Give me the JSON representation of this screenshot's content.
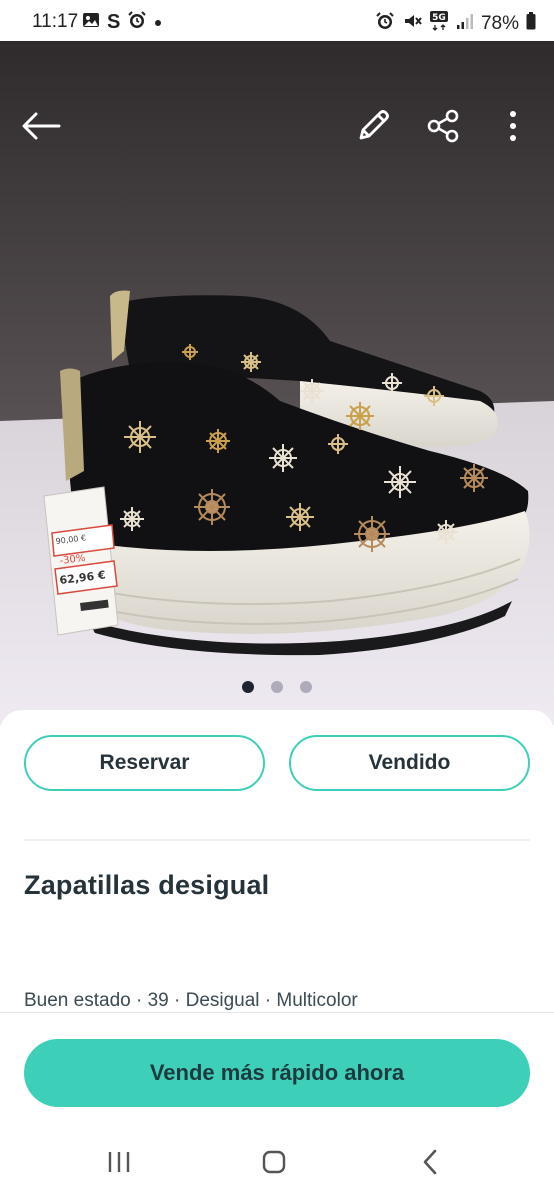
{
  "status_bar": {
    "time": "11:17",
    "left_icons": [
      "image-icon",
      "s-app-icon",
      "alarm-icon",
      "dot-icon"
    ],
    "right_icons": [
      "alarm-icon",
      "mute-icon",
      "5g-icon",
      "signal-icon"
    ],
    "battery": "78%"
  },
  "photo": {
    "toolbar_icons": [
      "back-arrow-icon",
      "pencil-icon",
      "share-icon",
      "more-vert-icon"
    ],
    "price_tag": {
      "old_price": "90,00 €",
      "discount": "-30%",
      "new_price": "62,96 €"
    },
    "carousel": {
      "count": 3,
      "active": 1
    }
  },
  "actions": {
    "reserve_label": "Reservar",
    "sold_label": "Vendido"
  },
  "listing": {
    "title": "Zapatillas desigual",
    "details": "Buen estado · 39 · Desigual · Multicolor"
  },
  "cta": {
    "label": "Vende más rápido ahora"
  },
  "colors": {
    "accent": "#3ecfb9",
    "text": "#26333a"
  }
}
